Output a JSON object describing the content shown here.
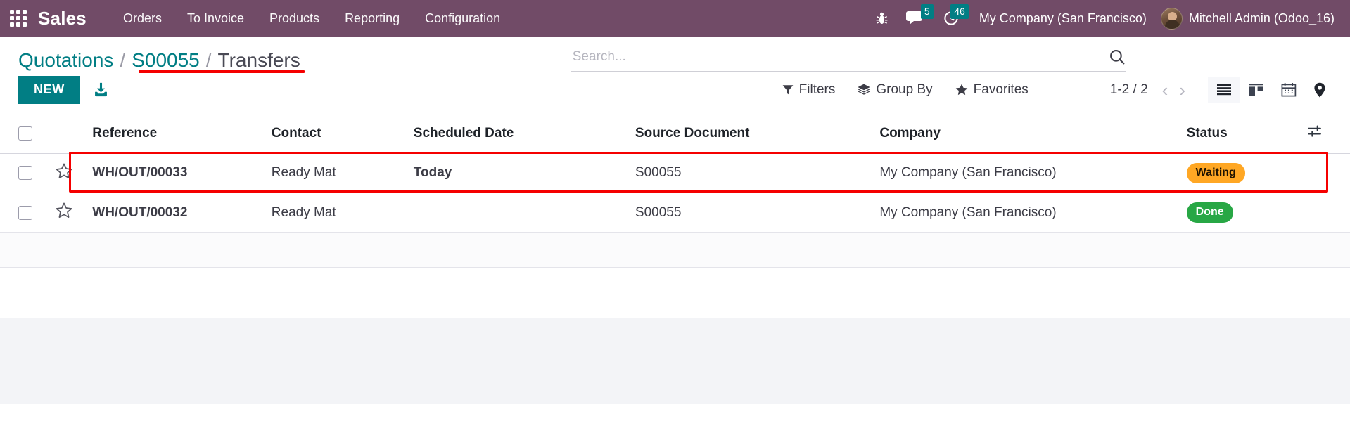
{
  "navbar": {
    "apps_icon": "apps-grid-icon",
    "brand": "Sales",
    "menu_items": [
      {
        "label": "Orders"
      },
      {
        "label": "To Invoice"
      },
      {
        "label": "Products"
      },
      {
        "label": "Reporting"
      },
      {
        "label": "Configuration"
      }
    ],
    "debug_icon": "bug-icon",
    "messages": {
      "icon": "chat-bubble-icon",
      "count": "5"
    },
    "activities": {
      "icon": "clock-icon",
      "count": "46"
    },
    "company": "My Company (San Francisco)",
    "user": "Mitchell Admin (Odoo_16)",
    "avatar_icon": "user-avatar"
  },
  "breadcrumb": {
    "items": [
      {
        "label": "Quotations",
        "type": "link"
      },
      {
        "label": "S00055",
        "type": "link"
      },
      {
        "label": "Transfers",
        "type": "current"
      }
    ],
    "separator": "/"
  },
  "control_panel": {
    "new_label": "NEW",
    "import_icon": "import-download-icon",
    "search": {
      "placeholder": "Search...",
      "value": "",
      "icon": "search-icon"
    },
    "filters": [
      {
        "label": "Filters",
        "icon": "filter-funnel-icon"
      },
      {
        "label": "Group By",
        "icon": "layers-icon"
      },
      {
        "label": "Favorites",
        "icon": "star-icon"
      }
    ],
    "pager": {
      "count": "1-2 / 2",
      "prev_icon": "chevron-left-icon",
      "next_icon": "chevron-right-icon"
    },
    "views": [
      {
        "name": "list",
        "icon": "list-view-icon",
        "active": true
      },
      {
        "name": "kanban",
        "icon": "kanban-view-icon",
        "active": false
      },
      {
        "name": "calendar",
        "icon": "calendar-view-icon",
        "active": false
      },
      {
        "name": "map",
        "icon": "map-pin-view-icon",
        "active": false
      }
    ]
  },
  "table": {
    "columns": [
      {
        "key": "reference",
        "label": "Reference"
      },
      {
        "key": "contact",
        "label": "Contact"
      },
      {
        "key": "scheduled_date",
        "label": "Scheduled Date"
      },
      {
        "key": "source_document",
        "label": "Source Document"
      },
      {
        "key": "company",
        "label": "Company"
      },
      {
        "key": "status",
        "label": "Status"
      }
    ],
    "optional_columns_icon": "column-settings-icon",
    "select_all_icon": "checkbox-unchecked",
    "rows": [
      {
        "reference": "WH/OUT/00033",
        "contact": "Ready Mat",
        "scheduled_date": "Today",
        "source_document": "S00055",
        "company": "My Company (San Francisco)",
        "status": "Waiting",
        "status_color": "#FFA724",
        "highlighted": true
      },
      {
        "reference": "WH/OUT/00032",
        "contact": "Ready Mat",
        "scheduled_date": "",
        "source_document": "S00055",
        "company": "My Company (San Francisco)",
        "status": "Done",
        "status_color": "#28A745",
        "highlighted": false
      }
    ]
  },
  "annotations": {
    "color": "#f50000",
    "breadcrumb_underline": true,
    "row_box_target": "WH/OUT/00033"
  },
  "colors": {
    "brand_purple": "#714B67",
    "accent_teal": "#017E84",
    "status_waiting": "#FFA724",
    "status_done": "#28A745",
    "annotation_red": "#f50000"
  }
}
